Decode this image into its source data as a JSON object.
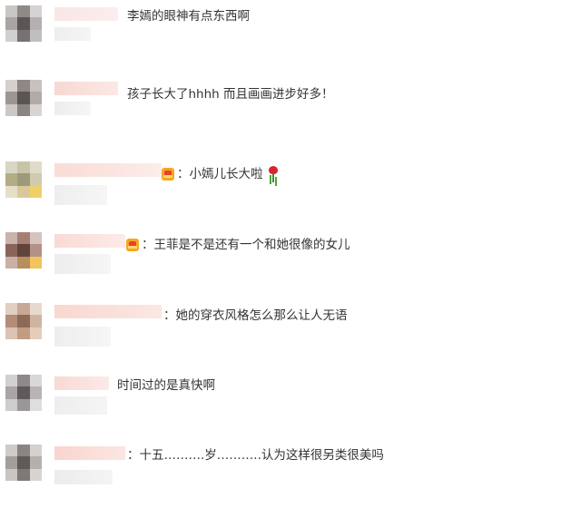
{
  "comments": [
    {
      "text": "李嫣的眼神有点东西啊",
      "badge": false,
      "emoji": null,
      "avatar_colors": [
        "#c9c6c4",
        "#8e8a88",
        "#d6d3d2",
        "#a9a5a5",
        "#5b5656",
        "#b4b0b1",
        "#d2cfcf",
        "#777272",
        "#c1bebe"
      ],
      "name_blur_colors": [
        "#f9e6e6",
        "#fbeeee"
      ],
      "sub_blur_colors": [
        "#eeeeee",
        "#f5f5f5"
      ]
    },
    {
      "text": "孩子长大了hhhh 而且画画进步好多！",
      "badge": false,
      "emoji": null,
      "avatar_colors": [
        "#d5cfcd",
        "#8f8785",
        "#c7c1bf",
        "#9b9694",
        "#5a5452",
        "#b0aaa8",
        "#cdc8c6",
        "#8a8482",
        "#d9d4d2"
      ],
      "name_blur_colors": [
        "#f8d8d2",
        "#fbe8e5"
      ],
      "sub_blur_colors": [
        "#ededed",
        "#f6f6f6"
      ]
    },
    {
      "text": "：小嫣儿长大啦",
      "badge": true,
      "emoji": "rose-icon",
      "avatar_colors": [
        "#d8d7c4",
        "#c8c4a6",
        "#e0dcc8",
        "#b3ad86",
        "#9d9a7c",
        "#cfcbb0",
        "#e4e0c8",
        "#d9c89a",
        "#f0cf6b"
      ],
      "name_blur_colors": [
        "#f9dcd6",
        "#fcecea"
      ],
      "sub_blur_colors": [
        "#eeeeee",
        "#f6f6f6"
      ]
    },
    {
      "text": "：王菲是不是还有一个和她很像的女儿",
      "badge": true,
      "emoji": null,
      "avatar_colors": [
        "#c9b3ad",
        "#a47f72",
        "#d7c3bd",
        "#8a6458",
        "#5f443b",
        "#b29186",
        "#cbb0a8",
        "#b78e5e",
        "#f2c45b"
      ],
      "name_blur_colors": [
        "#f9dad4",
        "#fcebe8"
      ],
      "sub_blur_colors": [
        "#ededed",
        "#f6f6f6"
      ]
    },
    {
      "text": "：她的穿衣风格怎么那么让人无语",
      "badge": false,
      "emoji": null,
      "avatar_colors": [
        "#e1cfc3",
        "#c7a896",
        "#e8d9cf",
        "#b38d77",
        "#8d6a58",
        "#d0b4a2",
        "#dcc3b3",
        "#c39b82",
        "#e6cdbb"
      ],
      "name_blur_colors": [
        "#f9d8d0",
        "#fbe7e2"
      ],
      "sub_blur_colors": [
        "#eeeeee",
        "#f6f6f6"
      ]
    },
    {
      "text": "时间过的是真快啊",
      "badge": false,
      "emoji": null,
      "avatar_colors": [
        "#d3d0d1",
        "#8d898a",
        "#dad7d8",
        "#a9a5a6",
        "#5e5a5b",
        "#b8b4b5",
        "#cfcccd",
        "#9b9798",
        "#e0dddd"
      ],
      "name_blur_colors": [
        "#f9d9d3",
        "#fbeae7"
      ],
      "sub_blur_colors": [
        "#eeeeee",
        "#f5f5f5"
      ]
    },
    {
      "text": "：十五……….岁………..认为这样很另类很美吗",
      "badge": false,
      "emoji": null,
      "avatar_colors": [
        "#cfcbc9",
        "#8a8583",
        "#d5d1cf",
        "#a39e9c",
        "#5f5a58",
        "#b5b0ae",
        "#c9c5c3",
        "#7e7977",
        "#d8d4d2"
      ],
      "name_blur_colors": [
        "#f8d5ce",
        "#fbe6e2"
      ],
      "sub_blur_colors": [
        "#ececec",
        "#f4f4f4"
      ]
    }
  ]
}
